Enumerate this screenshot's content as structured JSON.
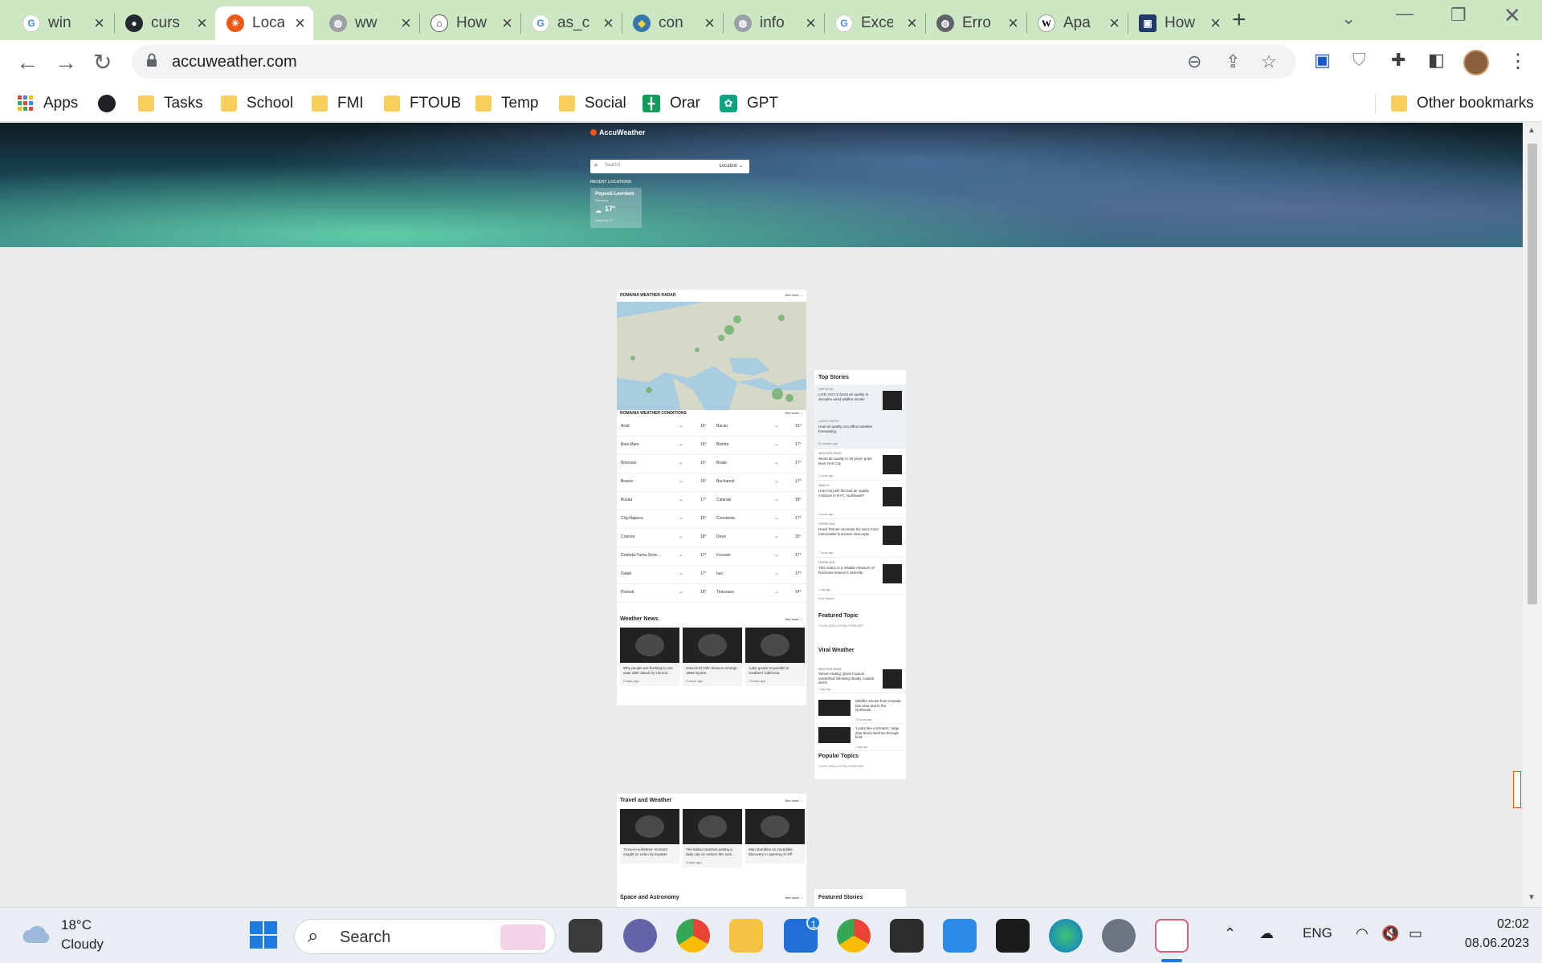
{
  "tabs": [
    {
      "label": "win",
      "icon": "google-icon"
    },
    {
      "label": "curs",
      "icon": "github-icon"
    },
    {
      "label": "Loca",
      "icon": "accuweather-icon",
      "active": true
    },
    {
      "label": "ww",
      "icon": "globe-icon"
    },
    {
      "label": "How",
      "icon": "house-icon"
    },
    {
      "label": "as_c",
      "icon": "google-icon"
    },
    {
      "label": "con",
      "icon": "python-icon"
    },
    {
      "label": "info",
      "icon": "globe-icon"
    },
    {
      "label": "Exce",
      "icon": "google-icon"
    },
    {
      "label": "Erro",
      "icon": "globe-icon"
    },
    {
      "label": "Apa",
      "icon": "wikipedia-icon"
    },
    {
      "label": "How",
      "icon": "gov-icon"
    }
  ],
  "address": {
    "url": "accuweather.com"
  },
  "bookmarks": {
    "apps": "Apps",
    "items": [
      "Tasks",
      "School",
      "FMI",
      "FTOUB",
      "Temp",
      "Social",
      "Orar",
      "GPT"
    ],
    "other": "Other bookmarks"
  },
  "page": {
    "brand": "AccuWeather",
    "search_placeholder": "Search",
    "location_label": "Location",
    "recent_label": "RECENT LOCATIONS",
    "recent": {
      "name": "Popesti Leordeni",
      "region": "Romania",
      "temp": "17°",
      "realfeel": "RealFeel 17°"
    },
    "radar_title": "ROMANIA WEATHER RADAR",
    "see_more": "See more",
    "conditions_title": "ROMANIA WEATHER CONDITIONS",
    "conditions": [
      [
        "Arad",
        "16°",
        "Bacau",
        "15°"
      ],
      [
        "Baia Mare",
        "16°",
        "Bistrita",
        "17°"
      ],
      [
        "Botosani",
        "15°",
        "Braila",
        "17°"
      ],
      [
        "Brasov",
        "15°",
        "Bucharest",
        "17°"
      ],
      [
        "Buzau",
        "17°",
        "Calarasi",
        "18°"
      ],
      [
        "Cluj-Napoca",
        "15°",
        "Constanta",
        "17°"
      ],
      [
        "Craiova",
        "18°",
        "Deva",
        "15°"
      ],
      [
        "Drobeta-Turnu Seve...",
        "17°",
        "Focsani",
        "17°"
      ],
      [
        "Galati",
        "17°",
        "Iasi",
        "17°"
      ],
      [
        "Ploiesti",
        "18°",
        "Timisoara",
        "14°"
      ]
    ],
    "weather_news_title": "Weather News",
    "weather_news": [
      {
        "title": "Why people are flocking to one state after attack by Hurrica...",
        "time": "3 days ago"
      },
      {
        "title": "Hanoi's El Niño lessons emerge, 1998 reports",
        "time": "2 hours ago"
      },
      {
        "title": "'Lake grows' to parallel in Southern California",
        "time": "7 hours ago"
      }
    ],
    "travel_title": "Travel and Weather",
    "travel_news": [
      {
        "title": "'Once-in-a-lifetime' moment caught on video by kayaker",
        "time": ""
      },
      {
        "title": "The Italian beaches putting a daily cap on visitors this sum...",
        "time": "4 days ago"
      },
      {
        "title": "Man stumbles on incredible discovery in opening of cliff",
        "time": ""
      }
    ],
    "space_title": "Space and Astronomy",
    "top_stories_title": "Top Stories",
    "top_stories": [
      {
        "cat": "LIVE BLOG",
        "title": "LIVE: NYC's worst air quality in decades amid wildfire smoke",
        "age": ""
      },
      {
        "cat": "LATEST ENTRY",
        "title": "How air quality can affect weather forecasting",
        "age": "31 minutes ago"
      },
      {
        "cat": "WEATHER NEWS",
        "title": "Worst air quality in 20 years grips New York City",
        "age": "2 hours ago"
      },
      {
        "cat": "HEALTH",
        "title": "How long will the bad air quality continue in NYC, Northeast?",
        "age": "4 hours ago"
      },
      {
        "cat": "HURRICANE",
        "title": "Reed Timmer recounts his top 5 most memorable hurricane intercepts",
        "age": "7 hours ago"
      },
      {
        "cat": "HURRICANE",
        "title": "This metric is a reliable measure of hurricane season's intensity",
        "age": "1 day ago"
      }
    ],
    "more_stories": "More Stories",
    "featured_topic_title": "Featured Topic",
    "featured_topic_sub": "YOUR LOCAL LETHAL FORECAST",
    "viral_title": "Viral Weather",
    "viral": [
      {
        "cat": "WEATHER NEWS",
        "title": "'Never-ending' ghost tropical unearthed following deadly coastal storm",
        "age": "1 day ago"
      },
      {
        "cat": "",
        "title": "Wildfire smoke from Canada hits area and in the Northeast",
        "age": "12 hours ago"
      },
      {
        "cat": "",
        "title": "'Looks like a tornado,' large dust devil marches through field",
        "age": "1 day ago"
      }
    ],
    "popular_title": "Popular Topics",
    "popular_sub": "YOUR LOCAL LETHAL FORECAST",
    "featured_stories_title": "Featured Stories"
  },
  "taskbar": {
    "weather_temp": "18°C",
    "weather_cond": "Cloudy",
    "search_label": "Search",
    "lang": "ENG",
    "time": "02:02",
    "date": "08.06.2023",
    "mail_badge": "1"
  },
  "colors": {
    "tabstrip": "#cde7c3",
    "accent": "#f05514",
    "folder": "#f9ce5a"
  }
}
